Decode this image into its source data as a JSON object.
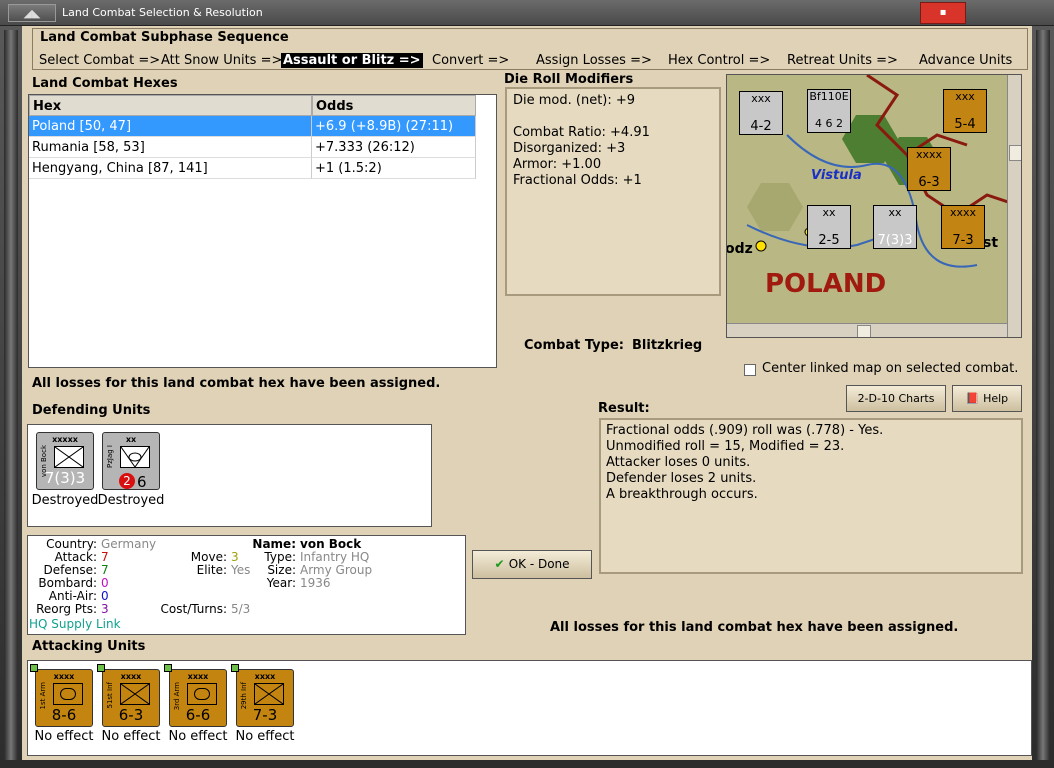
{
  "window": {
    "title": "Land Combat Selection & Resolution"
  },
  "subphase": {
    "heading": "Land Combat Subphase Sequence",
    "steps": [
      "Select Combat =>",
      "Att Snow Units =>",
      "Assault or Blitz =>",
      "Convert =>",
      "Assign Losses =>",
      "Hex Control =>",
      "Retreat Units =>",
      "Advance Units"
    ]
  },
  "hexes": {
    "heading": "Land Combat Hexes",
    "columns": [
      "Hex",
      "Odds"
    ],
    "rows": [
      {
        "hex": "Poland [50, 47]",
        "odds": "+6.9 (+8.9B) (27:11)"
      },
      {
        "hex": "Rumania [58, 53]",
        "odds": "+7.333 (26:12)"
      },
      {
        "hex": "Hengyang, China [87, 141]",
        "odds": "+1 (1.5:2)"
      }
    ]
  },
  "die_roll": {
    "heading": "Die Roll Modifiers",
    "lines": [
      "Die mod. (net): +9",
      "",
      "Combat Ratio: +4.91",
      "Disorganized: +3",
      "Armor: +1.00",
      "Fractional Odds: +1"
    ]
  },
  "combat_type": {
    "label": "Combat Type:",
    "value": "Blitzkrieg"
  },
  "map": {
    "labels": {
      "country": "POLAND",
      "river": "Vistula",
      "city": "odz",
      "city2": "st"
    },
    "center_checkbox": "Center linked map on selected combat."
  },
  "losses_message": "All losses for this land combat hex have been assigned.",
  "buttons": {
    "charts": "2-D-10 Charts",
    "help": "Help",
    "ok": "OK - Done"
  },
  "defending": {
    "heading": "Defending Units",
    "units": [
      {
        "size": "xxxxx",
        "side": "von Bock",
        "strength": "7(3)3",
        "status": "Destroyed"
      },
      {
        "size": "xx",
        "side": "PzJag I",
        "badge": "2",
        "strength": "6",
        "status": "Destroyed"
      }
    ]
  },
  "unit_info": {
    "country_label": "Country:",
    "country": "Germany",
    "attack_label": "Attack:",
    "attack": "7",
    "defense_label": "Defense:",
    "defense": "7",
    "bombard_label": "Bombard:",
    "bombard": "0",
    "antiair_label": "Anti-Air:",
    "antiair": "0",
    "reorg_label": "Reorg Pts:",
    "reorg": "3",
    "move_label": "Move:",
    "move": "3",
    "elite_label": "Elite:",
    "elite": "Yes",
    "cost_label": "Cost/Turns:",
    "cost": "5/3",
    "name_label": "Name:",
    "name": "von Bock",
    "type_label": "Type:",
    "type": "Infantry HQ",
    "size_label": "Size:",
    "size": "Army Group",
    "year_label": "Year:",
    "year": "1936",
    "supply": "HQ Supply Link"
  },
  "result": {
    "heading": "Result:",
    "lines": [
      "Fractional odds (.909) roll was (.778)  - Yes.",
      "Unmodified roll = 15, Modified = 23.",
      "Attacker loses 0 units.",
      "Defender loses 2 units.",
      "A breakthrough occurs."
    ]
  },
  "attacking": {
    "heading": "Attacking Units",
    "units": [
      {
        "size": "xxxx",
        "side": "1st Arm",
        "strength": "8-6",
        "status": "No effect",
        "kind": "armor"
      },
      {
        "size": "xxxx",
        "side": "51st Inf",
        "strength": "6-3",
        "status": "No effect",
        "kind": "infantry"
      },
      {
        "size": "xxxx",
        "side": "3rd Arm",
        "strength": "6-6",
        "status": "No effect",
        "kind": "armor"
      },
      {
        "size": "xxxx",
        "side": "29th Inf",
        "strength": "7-3",
        "status": "No effect",
        "kind": "infantry"
      }
    ]
  },
  "map_counters": [
    {
      "size": "xxx",
      "str": "4-2",
      "color": "grey"
    },
    {
      "size": "Bf110E",
      "str": "4 6 2",
      "color": "grey"
    },
    {
      "size": "xxx",
      "str": "5-4",
      "color": "gold"
    },
    {
      "size": "xxxx",
      "str": "6-3",
      "color": "gold"
    },
    {
      "size": "xx",
      "str": "2-5",
      "color": "grey"
    },
    {
      "size": "xx",
      "str": "7(3)3",
      "color": "grey"
    },
    {
      "size": "xxxx",
      "str": "7-3",
      "color": "gold"
    }
  ]
}
